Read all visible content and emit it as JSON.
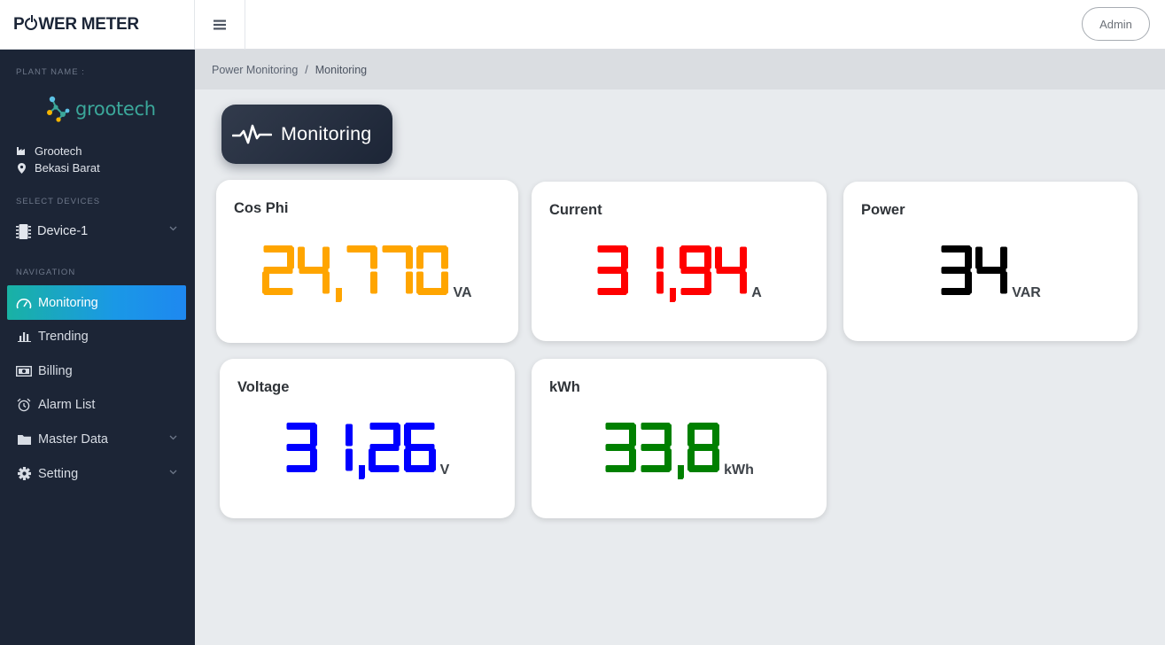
{
  "app": {
    "title": "POWER METER",
    "title_pre": "P",
    "title_post": "WER METER"
  },
  "header": {
    "menu_icon": "hamburger-icon",
    "user_button": "Admin"
  },
  "sidebar": {
    "plant_label": "PLANT NAME :",
    "logo_text": "grootech",
    "plant_name": "Grootech",
    "plant_location": "Bekasi Barat",
    "devices_label": "SELECT DEVICES",
    "selected_device": "Device-1",
    "navigation_label": "NAVIGATION",
    "nav": [
      {
        "label": "Monitoring",
        "icon": "gauge-icon",
        "active": true
      },
      {
        "label": "Trending",
        "icon": "bar-chart-icon"
      },
      {
        "label": "Billing",
        "icon": "money-icon"
      },
      {
        "label": "Alarm List",
        "icon": "alarm-clock-icon"
      },
      {
        "label": "Master Data",
        "icon": "folder-icon",
        "expandable": true
      },
      {
        "label": "Setting",
        "icon": "gear-icon",
        "expandable": true
      }
    ]
  },
  "breadcrumb": {
    "parent": "Power Monitoring",
    "separator": "/",
    "current": "Monitoring"
  },
  "page": {
    "title": "Monitoring",
    "title_icon": "pulse-icon"
  },
  "cards": [
    {
      "title": "Cos Phi",
      "value": "24,770",
      "unit": "VA",
      "color": "#ffa500"
    },
    {
      "title": "Current",
      "value": "31,94",
      "unit": "A",
      "color": "#ff0000"
    },
    {
      "title": "Power",
      "value": "34",
      "unit": "VAR",
      "color": "#000000"
    },
    {
      "title": "Voltage",
      "value": "31,26",
      "unit": "V",
      "color": "#0000ff"
    },
    {
      "title": "kWh",
      "value": "33,8",
      "unit": "kWh",
      "color": "#008000"
    }
  ]
}
